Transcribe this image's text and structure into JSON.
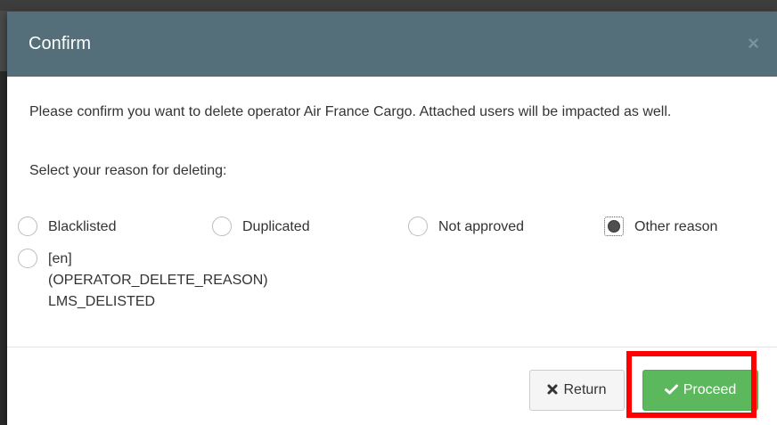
{
  "dialog": {
    "title": "Confirm",
    "close_glyph": "×",
    "message": "Please confirm you want to delete operator Air France Cargo. Attached users will be impacted as well.",
    "reason_prompt": "Select your reason for deleting:",
    "reasons": [
      {
        "label": "Blacklisted",
        "checked": false
      },
      {
        "label": "Duplicated",
        "checked": false
      },
      {
        "label": "Not approved",
        "checked": false
      },
      {
        "label": "Other reason",
        "checked": true
      },
      {
        "label": "[en]\n(OPERATOR_DELETE_REASON)\nLMS_DELISTED",
        "checked": false
      }
    ],
    "buttons": {
      "return_label": "Return",
      "return_icon": "x-icon",
      "proceed_label": "Proceed",
      "proceed_icon": "check-icon"
    }
  },
  "colors": {
    "header": "#546e7a",
    "proceed": "#5cb85c",
    "highlight": "#ff0000"
  }
}
